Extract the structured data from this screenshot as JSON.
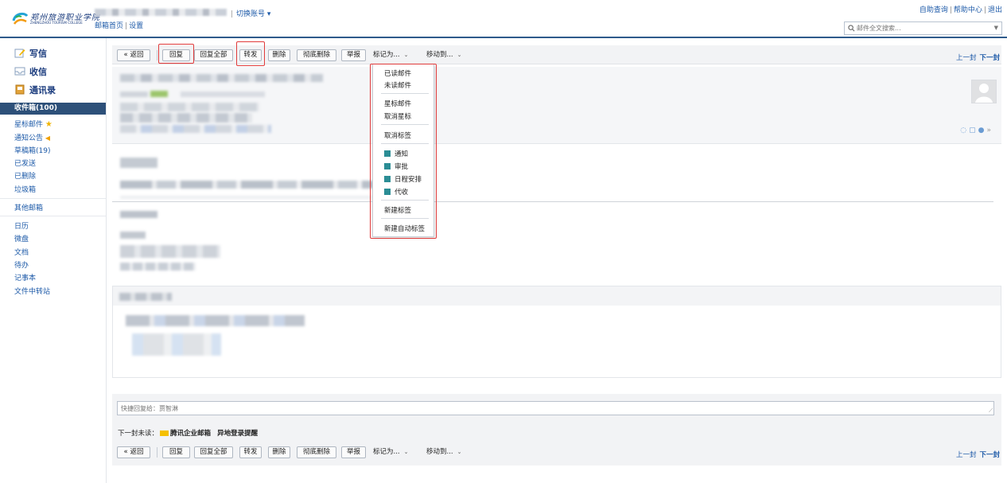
{
  "header": {
    "logo_cn": "郑州旅游职业学院",
    "logo_en": "ZHENGZHOU TOURISM COLLEGE",
    "switch_account": "切换账号",
    "mail_home": "邮箱首页",
    "settings": "设置",
    "top_links": [
      "自助查询",
      "帮助中心",
      "退出"
    ],
    "search_placeholder": "邮件全文搜索..."
  },
  "sidebar": {
    "compose": "写信",
    "receive": "收信",
    "contacts": "通讯录",
    "inbox": "收件箱(100)",
    "folders": {
      "starred": "星标邮件",
      "notices": "通知公告",
      "drafts": "草稿箱(19)",
      "sent": "已发送",
      "deleted": "已删除",
      "spam": "垃圾箱",
      "other_mailbox": "其他邮箱",
      "calendar": "日历",
      "disk": "微盘",
      "docs": "文档",
      "todo": "待办",
      "notes": "记事本",
      "transfer": "文件中转站"
    }
  },
  "toolbar": {
    "back": "« 返回",
    "reply": "回复",
    "reply_all": "回复全部",
    "forward": "转发",
    "delete": "删除",
    "delete_perm": "彻底删除",
    "report": "举报",
    "mark_as": "标记为...",
    "move_to": "移动到...",
    "prev": "上一封",
    "next": "下一封"
  },
  "dropdown": {
    "read": "已读邮件",
    "unread": "未读邮件",
    "star": "星标邮件",
    "unstar": "取消星标",
    "untag": "取消标签",
    "tags": [
      {
        "label": "通知",
        "color": "#2b8d95"
      },
      {
        "label": "审批",
        "color": "#2b8d95"
      },
      {
        "label": "日程安排",
        "color": "#2b8d95"
      },
      {
        "label": "代收",
        "color": "#2b8d95"
      }
    ],
    "new_tag": "新建标签",
    "new_auto_tag": "新建自动标签"
  },
  "quick_reply": {
    "placeholder": "快捷回复给：贾智淋"
  },
  "next_unread": {
    "label": "下一封未读：",
    "sender": "腾讯企业邮箱",
    "subject": "异地登录提醒"
  },
  "colors": {
    "accent": "#2d5079",
    "link": "#1d5aa8",
    "highlight": "#e03b3b",
    "tag": "#2b8d95"
  }
}
